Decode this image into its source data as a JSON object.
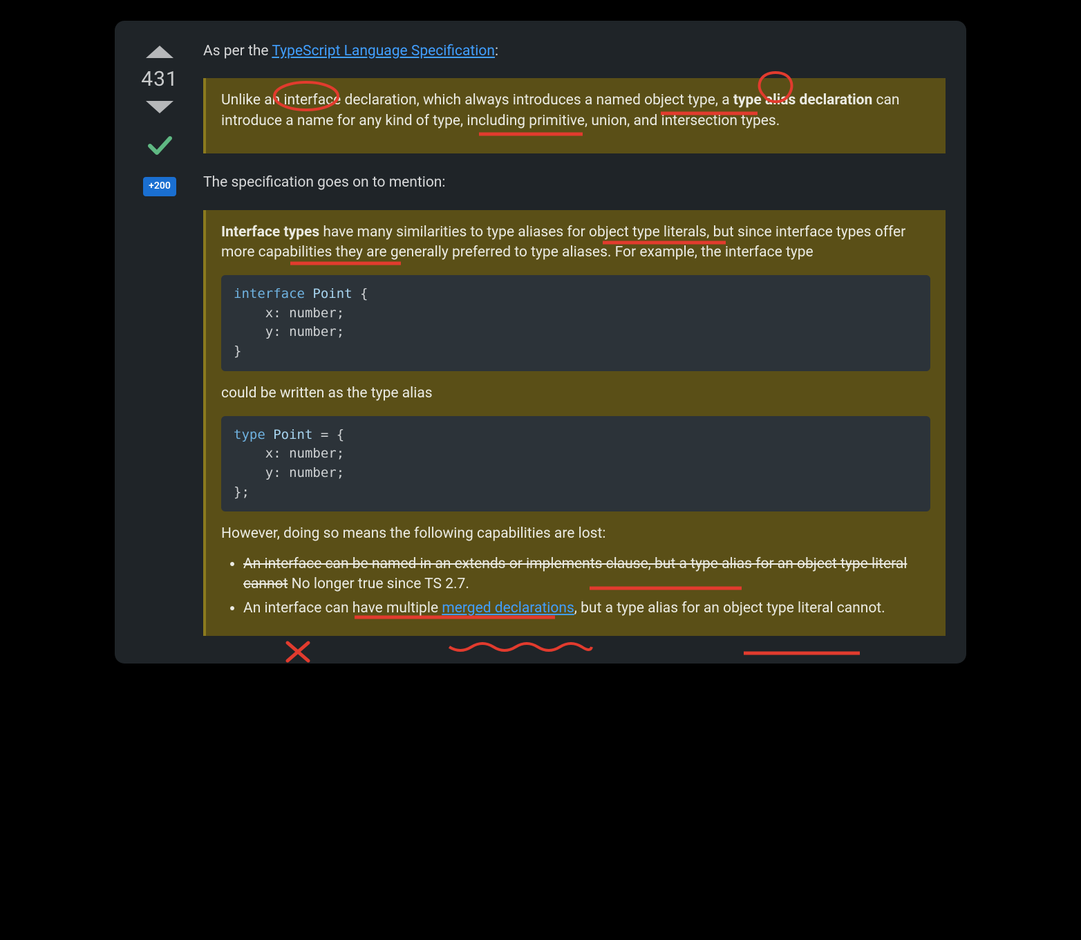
{
  "vote": {
    "score": "431",
    "bounty": "+200"
  },
  "intro": {
    "prefix": "As per the ",
    "link_text": "TypeScript Language Specification",
    "suffix": ":"
  },
  "quote1": {
    "t1": "Unlike an ",
    "t2": "interface",
    "t3": " declaration, which always introduces a named object type, a ",
    "bold1": "type alias declaration",
    "t4": " can introduce a name for any kind of type, including primitive, union, and intersection types."
  },
  "followup": "The specification goes on to mention:",
  "quote2": {
    "p1_pre": "",
    "bold1": "Interface types",
    "p1_mid": " have many similarities to type aliases for object type literals, but since interface types offer more capabilities they are generally preferred to type aliases. For example, the interface type",
    "code1_kw": "interface",
    "code1_name": "Point",
    "code1_body": " {\n    x: number;\n    y: number;\n}",
    "p2": "could be written as the type alias",
    "code2_kw": "type",
    "code2_name": "Point",
    "code2_body": " = {\n    x: number;\n    y: number;\n};",
    "p3": "However, doing so means the following capabilities are lost:",
    "li1_strike": "An interface can be named in an extends or implements clause, but a type alias for an object type literal cannot",
    "li1_rest": " No longer true since TS 2.7.",
    "li2_a": "An interface can have multiple ",
    "li2_link": "merged declarations",
    "li2_b": ", but a type alias for an object type literal cannot."
  },
  "colors": {
    "annotation": "#e23b2e"
  }
}
